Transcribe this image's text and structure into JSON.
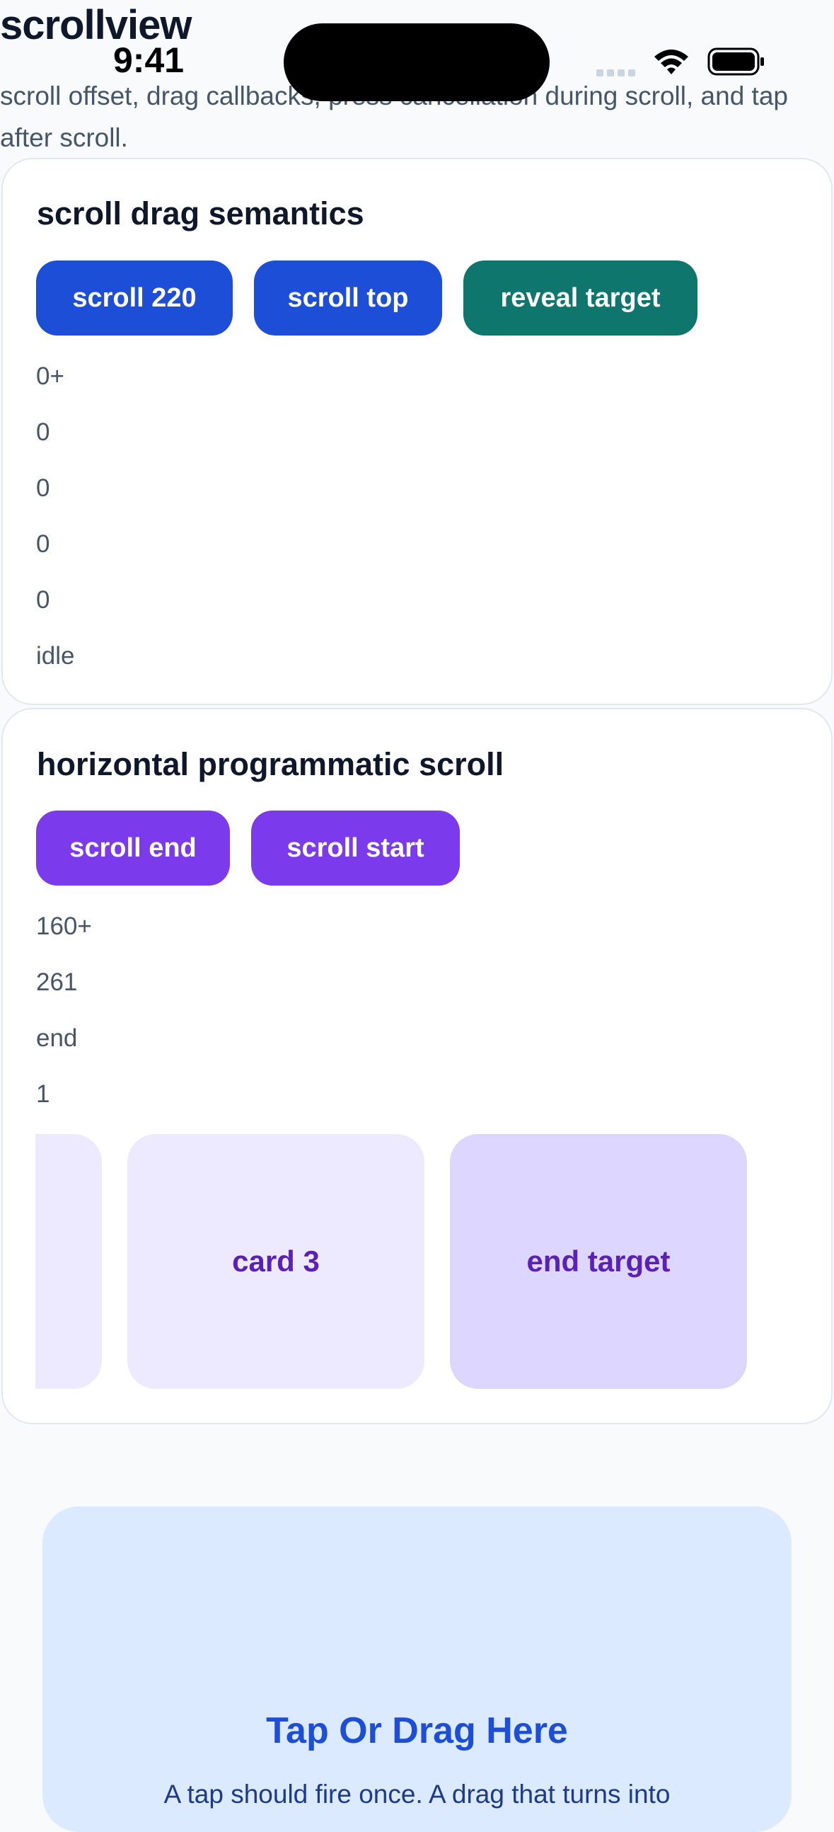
{
  "page": {
    "title": "scrollview",
    "description": "scroll offset, drag callbacks, press cancellation during scroll, and tap after scroll."
  },
  "status_bar": {
    "time": "9:41",
    "icons": [
      "cellular-signal-icon",
      "wifi-icon",
      "battery-icon"
    ]
  },
  "scroll_drag": {
    "title": "scroll drag semantics",
    "buttons": {
      "scroll_220": "scroll 220",
      "scroll_top": "scroll top",
      "reveal_target": "reveal target"
    },
    "stats": [
      "0+",
      "0",
      "0",
      "0",
      "0",
      "idle"
    ]
  },
  "horizontal": {
    "title": "horizontal programmatic scroll",
    "buttons": {
      "scroll_end": "scroll end",
      "scroll_start": "scroll start"
    },
    "stats": [
      "160+",
      "261",
      "end",
      "1"
    ],
    "cards": [
      "",
      "card 3",
      "end target"
    ]
  },
  "tap_zone": {
    "title": "Tap Or Drag Here",
    "subtitle": "A tap should fire once. A drag that turns into"
  },
  "colors": {
    "primary_blue": "#1d4ed8",
    "teal": "#0f766e",
    "purple": "#7c3aed",
    "card_light": "#ede9fe",
    "card_target": "#ddd6fe",
    "tap_zone_bg": "#dbeafe"
  }
}
